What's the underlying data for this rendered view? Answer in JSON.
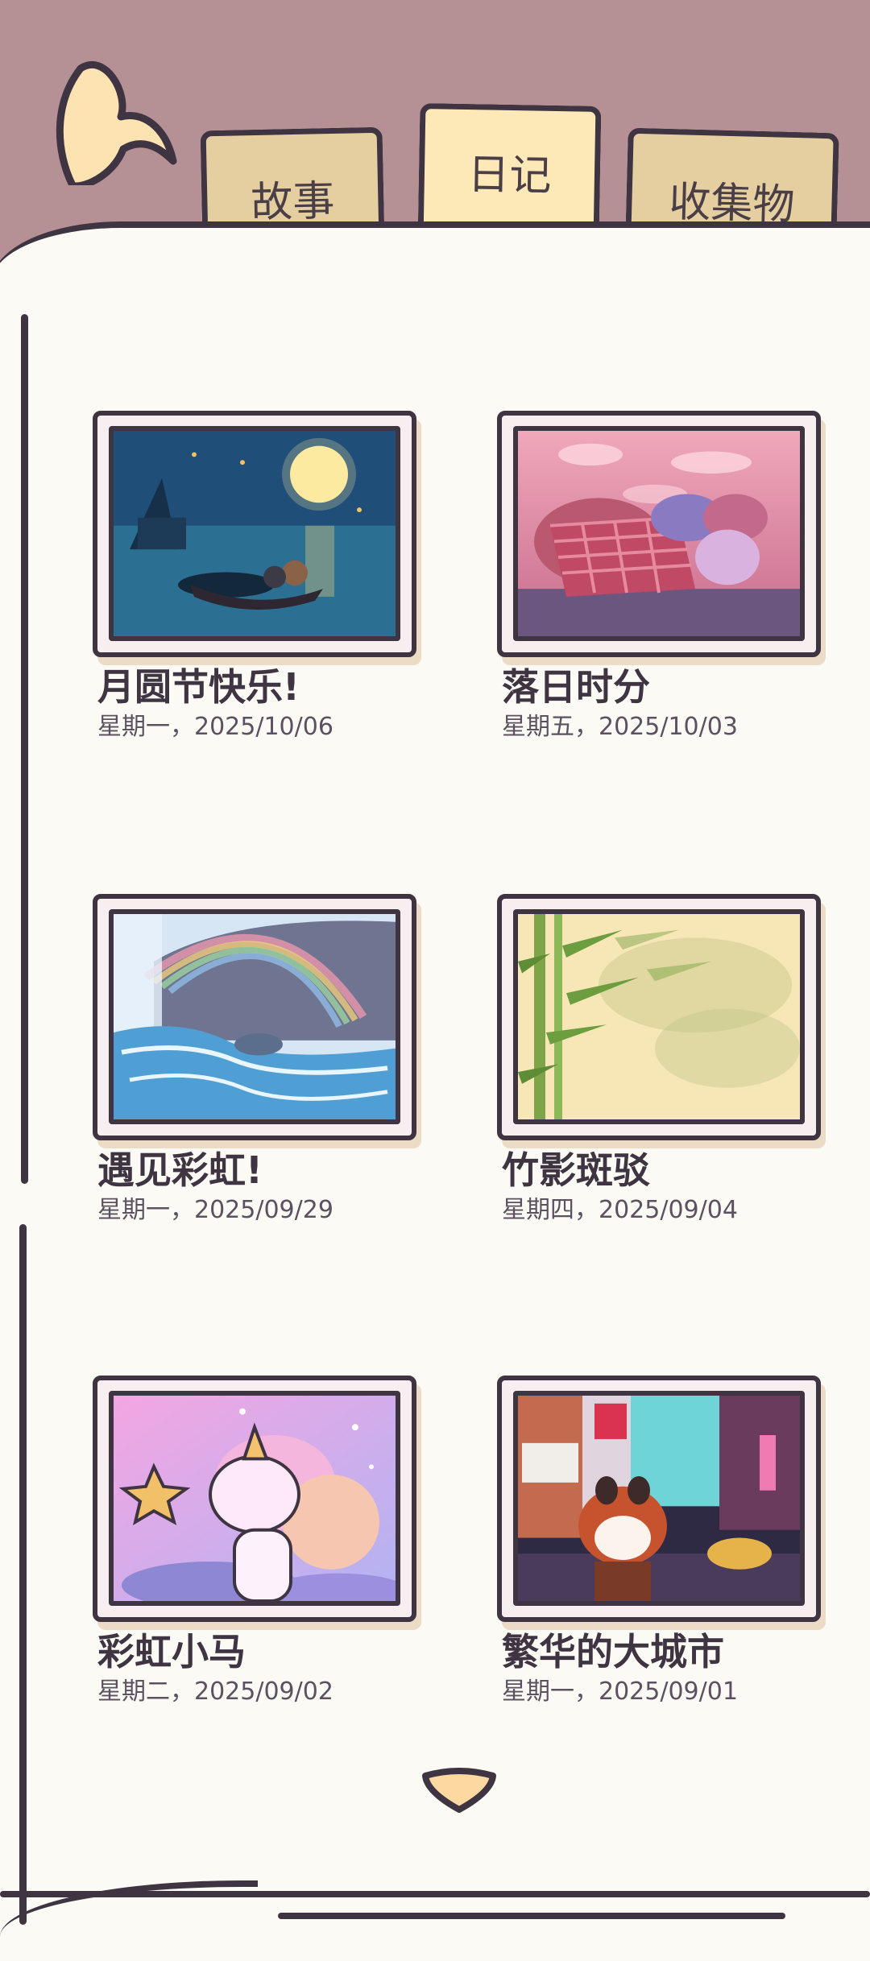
{
  "tabs": [
    {
      "label": "故事",
      "active": false
    },
    {
      "label": "日记",
      "active": true
    },
    {
      "label": "收集物",
      "active": false
    }
  ],
  "entries": [
    {
      "title": "月圆节快乐!",
      "date": "星期一，2025/10/06",
      "image": "moon-festival-lake-scene"
    },
    {
      "title": "落日时分",
      "date": "星期五，2025/10/03",
      "image": "sunset-picnic-blanket-scene"
    },
    {
      "title": "遇见彩虹!",
      "date": "星期一，2025/09/29",
      "image": "rainbow-waterfall-scene"
    },
    {
      "title": "竹影斑驳",
      "date": "星期四，2025/09/04",
      "image": "bamboo-shadow-scene"
    },
    {
      "title": "彩虹小马",
      "date": "星期二，2025/09/02",
      "image": "unicorn-pony-scene"
    },
    {
      "title": "繁华的大城市",
      "date": "星期一，2025/09/01",
      "image": "red-panda-city-scene"
    }
  ],
  "colors": {
    "background": "#b59195",
    "page": "#fcfaf5",
    "outline": "#3f3441",
    "tab": "#e5cfa0",
    "tab_active": "#fde8b8"
  },
  "icons": {
    "back": "back-arrow-icon",
    "scroll": "scroll-down-icon"
  }
}
